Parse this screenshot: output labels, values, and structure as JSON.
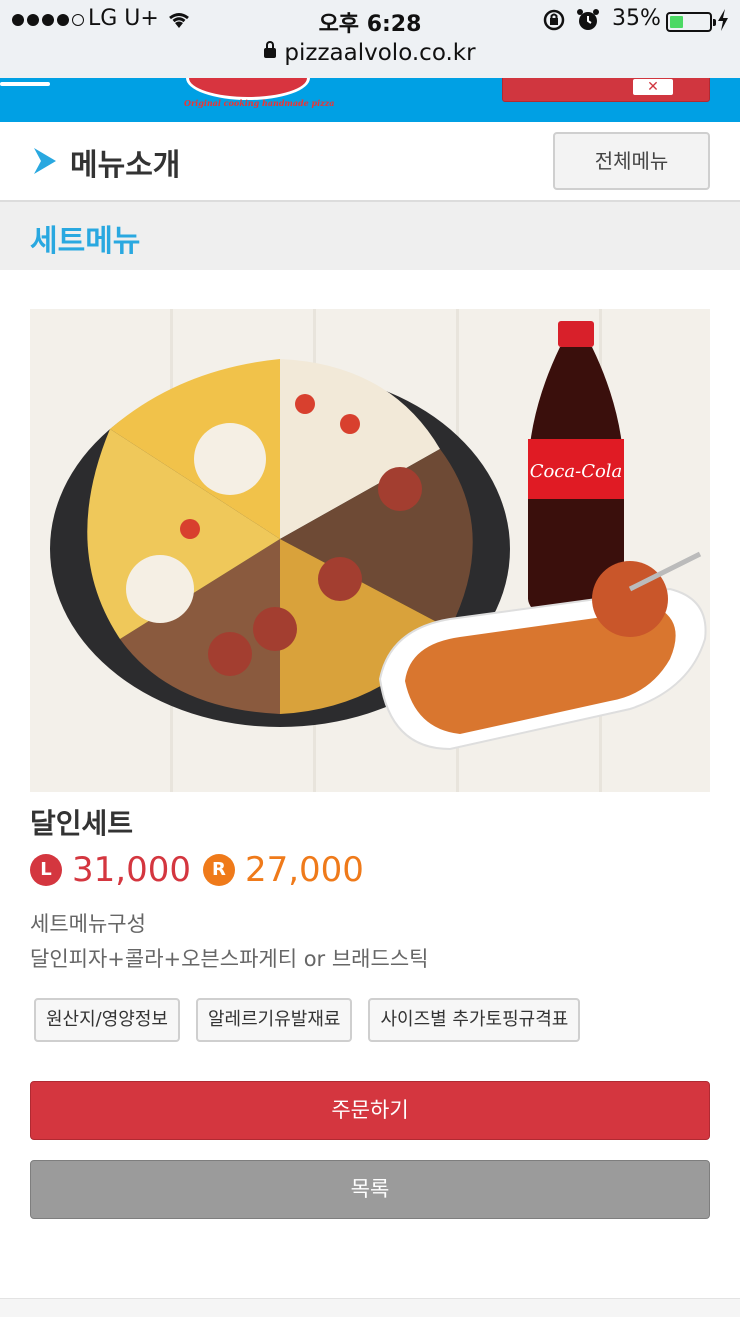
{
  "status_bar": {
    "carrier": "LG U+",
    "time": "오후 6:28",
    "battery": "35%",
    "battery_level": 0.35,
    "url": "pizzaalvolo.co.kr"
  },
  "header": {
    "logo_tagline": "Original cooking handmade pizza",
    "brand_color": "#00a0e4",
    "accent_color": "#d0363f"
  },
  "section": {
    "title": "메뉴소개",
    "all_menu_label": "전체메뉴",
    "category": "세트메뉴"
  },
  "product": {
    "name": "달인세트",
    "prices": [
      {
        "size": "L",
        "price": "31,000",
        "color": "#d4363f"
      },
      {
        "size": "R",
        "price": "27,000",
        "color": "#ef7a1a"
      }
    ],
    "set_label": "세트메뉴구성",
    "set_items": "달인피자+콜라+오븐스파게티 or 브래드스틱",
    "cola_label": "Coca-Cola",
    "info_buttons": [
      "원산지/영양정보",
      "알레르기유발재료",
      "사이즈별 추가토핑규격표"
    ]
  },
  "actions": {
    "order_label": "주문하기",
    "list_label": "목록"
  }
}
